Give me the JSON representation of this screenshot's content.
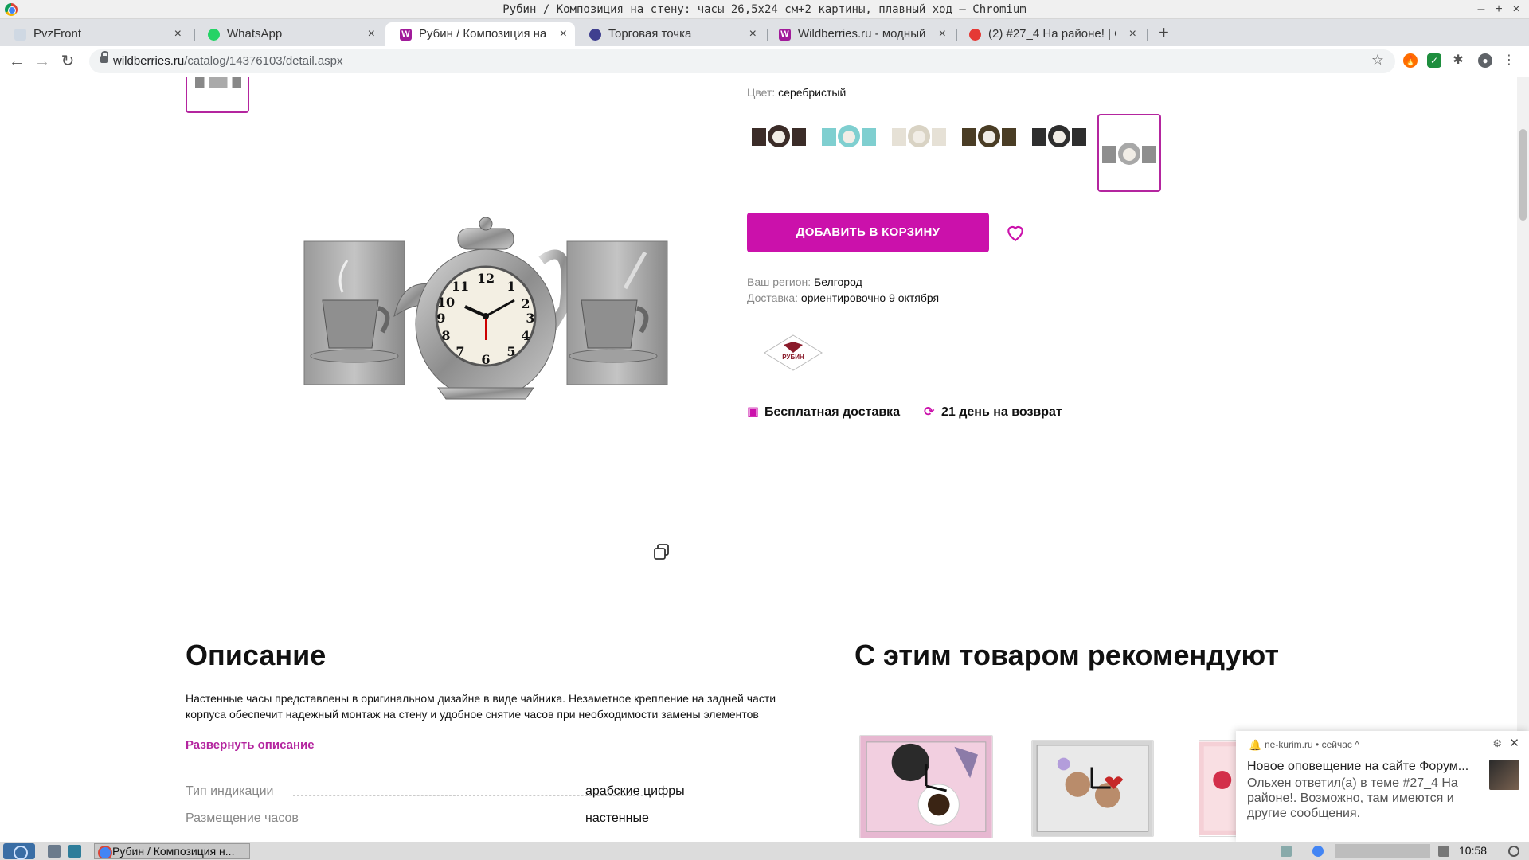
{
  "window": {
    "title": "Рубин / Композиция на стену: часы 26,5х24 см+2 картины, плавный ход – Chromium",
    "minimize_glyph": "–",
    "maximize_glyph": "+",
    "close_glyph": "×"
  },
  "tabs": [
    {
      "label": "PvzFront",
      "favicon_color": "#cfd8e3",
      "active": false
    },
    {
      "label": "WhatsApp",
      "favicon_color": "#25d366",
      "active": false
    },
    {
      "label": "Рубин / Композиция на с",
      "favicon_color": "#a11b9a",
      "active": true
    },
    {
      "label": "Торговая точка",
      "favicon_color": "#3f3f8f",
      "active": false
    },
    {
      "label": "Wildberries.ru - модный и",
      "favicon_color": "#a11b9a",
      "active": false
    },
    {
      "label": "(2) #27_4 На районе! | Стр",
      "favicon_color": "#e53935",
      "active": false
    }
  ],
  "tab_close_glyph": "×",
  "new_tab_glyph": "+",
  "address": {
    "host": "wildberries.ru",
    "path": "/catalog/14376103/detail.aspx"
  },
  "product": {
    "color_label": "Цвет:",
    "color_value": "серебристый",
    "add_to_cart": "ДОБАВИТЬ В КОРЗИНУ",
    "region_label": "Ваш регион:",
    "region_value": "Белгород",
    "delivery_label": "Доставка:",
    "delivery_value": "ориентировочно 9 октября",
    "perk_free_delivery": "Бесплатная доставка",
    "perk_return": "21 день на возврат",
    "brand_logo_text": "РУБИН",
    "swatches": [
      {
        "color": "#3b2c28",
        "accent": "#f1ede6"
      },
      {
        "color": "#7fcfd0",
        "accent": "#f1ede6"
      },
      {
        "color": "#e6e1d6",
        "accent": "#f1ede6"
      },
      {
        "color": "#4a3d25",
        "accent": "#f1ede6"
      },
      {
        "color": "#2e2e2e",
        "accent": "#f1ede6"
      },
      {
        "color": "#8e8e8e",
        "accent": "#f1ede6"
      }
    ]
  },
  "description": {
    "heading": "Описание",
    "text": "Настенные часы представлены в оригинальном дизайне в виде чайника. Незаметное крепление на задней части корпуса обеспечит надежный монтаж на стену и удобное снятие часов при необходимости замены элементов питания.",
    "expand": "Развернуть описание"
  },
  "specs": [
    {
      "key": "Тип индикации",
      "value": "арабские цифры"
    },
    {
      "key": "Размещение часов",
      "value": "настенные"
    }
  ],
  "recommend": {
    "heading": "С этим товаром рекомендуют"
  },
  "notification": {
    "source": "ne-kurim.ru",
    "when": "• сейчас ^",
    "title": "Новое оповещение на сайте Форум...",
    "body": "Ольхен ответил(а) в теме #27_4 На районе!. Возможно, там имеются и другие сообщения.",
    "gear_glyph": "⚙",
    "close_glyph": "✕",
    "bell_glyph": "🔔"
  },
  "taskbar": {
    "task_label": "Рубин / Композиция н...",
    "clock": "10:58"
  },
  "colors": {
    "accent": "#cb11ab",
    "accent_dark": "#b4259f"
  }
}
